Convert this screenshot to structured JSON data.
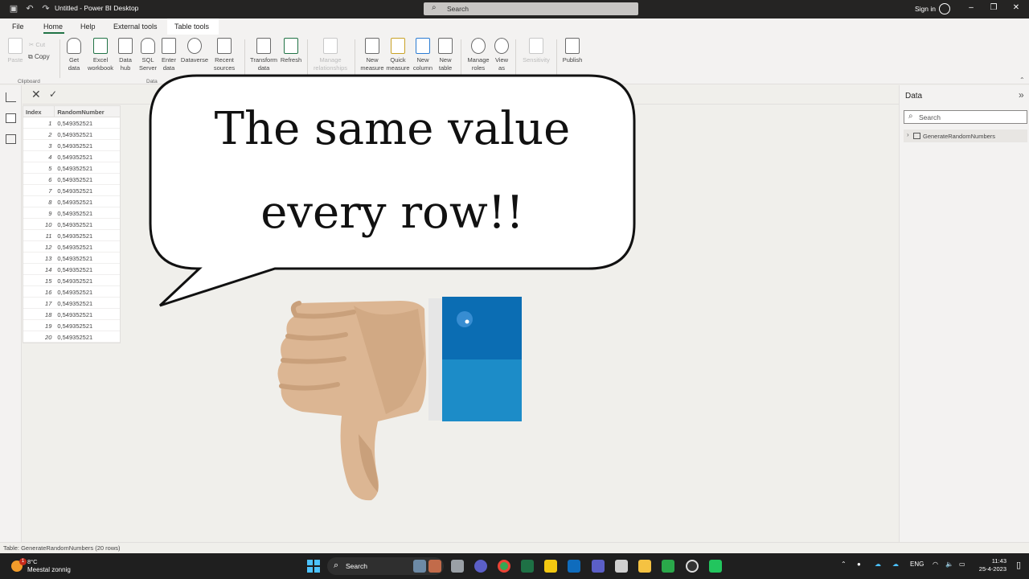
{
  "window": {
    "title": "Untitled - Power BI Desktop",
    "search_placeholder": "Search",
    "sign_in": "Sign in"
  },
  "tabs": [
    {
      "label": "File"
    },
    {
      "label": "Home"
    },
    {
      "label": "Help"
    },
    {
      "label": "External tools"
    },
    {
      "label": "Table tools"
    }
  ],
  "ribbon": {
    "paste": "Paste",
    "cut": "Cut",
    "copy": "Copy",
    "clipboard_group": "Clipboard",
    "data_group": "Data",
    "get_data": "Get data",
    "excel_workbook": "Excel workbook",
    "data_hub": "Data hub",
    "sql_server": "SQL Server",
    "enter_data": "Enter data",
    "dataverse": "Dataverse",
    "recent_sources": "Recent sources",
    "transform_data": "Transform data",
    "refresh": "Refresh",
    "manage_relationships": "Manage relationships",
    "new_measure": "New measure",
    "quick_measure": "Quick measure",
    "new_column": "New column",
    "new_table": "New table",
    "manage_roles": "Manage roles",
    "view_as": "View as",
    "sensitivity": "Sensitivity",
    "publish": "Publish"
  },
  "table": {
    "columns": [
      "Index",
      "RandomNumber"
    ],
    "rows": [
      [
        "1",
        "0,549352521"
      ],
      [
        "2",
        "0,549352521"
      ],
      [
        "3",
        "0,549352521"
      ],
      [
        "4",
        "0,549352521"
      ],
      [
        "5",
        "0,549352521"
      ],
      [
        "6",
        "0,549352521"
      ],
      [
        "7",
        "0,549352521"
      ],
      [
        "8",
        "0,549352521"
      ],
      [
        "9",
        "0,549352521"
      ],
      [
        "10",
        "0,549352521"
      ],
      [
        "11",
        "0,549352521"
      ],
      [
        "12",
        "0,549352521"
      ],
      [
        "13",
        "0,549352521"
      ],
      [
        "14",
        "0,549352521"
      ],
      [
        "15",
        "0,549352521"
      ],
      [
        "16",
        "0,549352521"
      ],
      [
        "17",
        "0,549352521"
      ],
      [
        "18",
        "0,549352521"
      ],
      [
        "19",
        "0,549352521"
      ],
      [
        "20",
        "0,549352521"
      ]
    ]
  },
  "data_pane": {
    "title": "Data",
    "search_placeholder": "Search",
    "table_name": "GenerateRandomNumbers"
  },
  "status_bar": "Table: GenerateRandomNumbers (20 rows)",
  "overlay": {
    "line1": "The same value",
    "line2": "every row!!"
  },
  "taskbar": {
    "weather_temp": "8°C",
    "weather_desc": "Meestal zonnig",
    "weather_badge": "1",
    "search": "Search",
    "language": "ENG",
    "time": "11:43",
    "date": "25-4-2023"
  },
  "colors": {
    "accent": "#217346",
    "sleeve_dark": "#0b6db3",
    "sleeve_light": "#1c8cc8",
    "hand": "#dcb693"
  }
}
